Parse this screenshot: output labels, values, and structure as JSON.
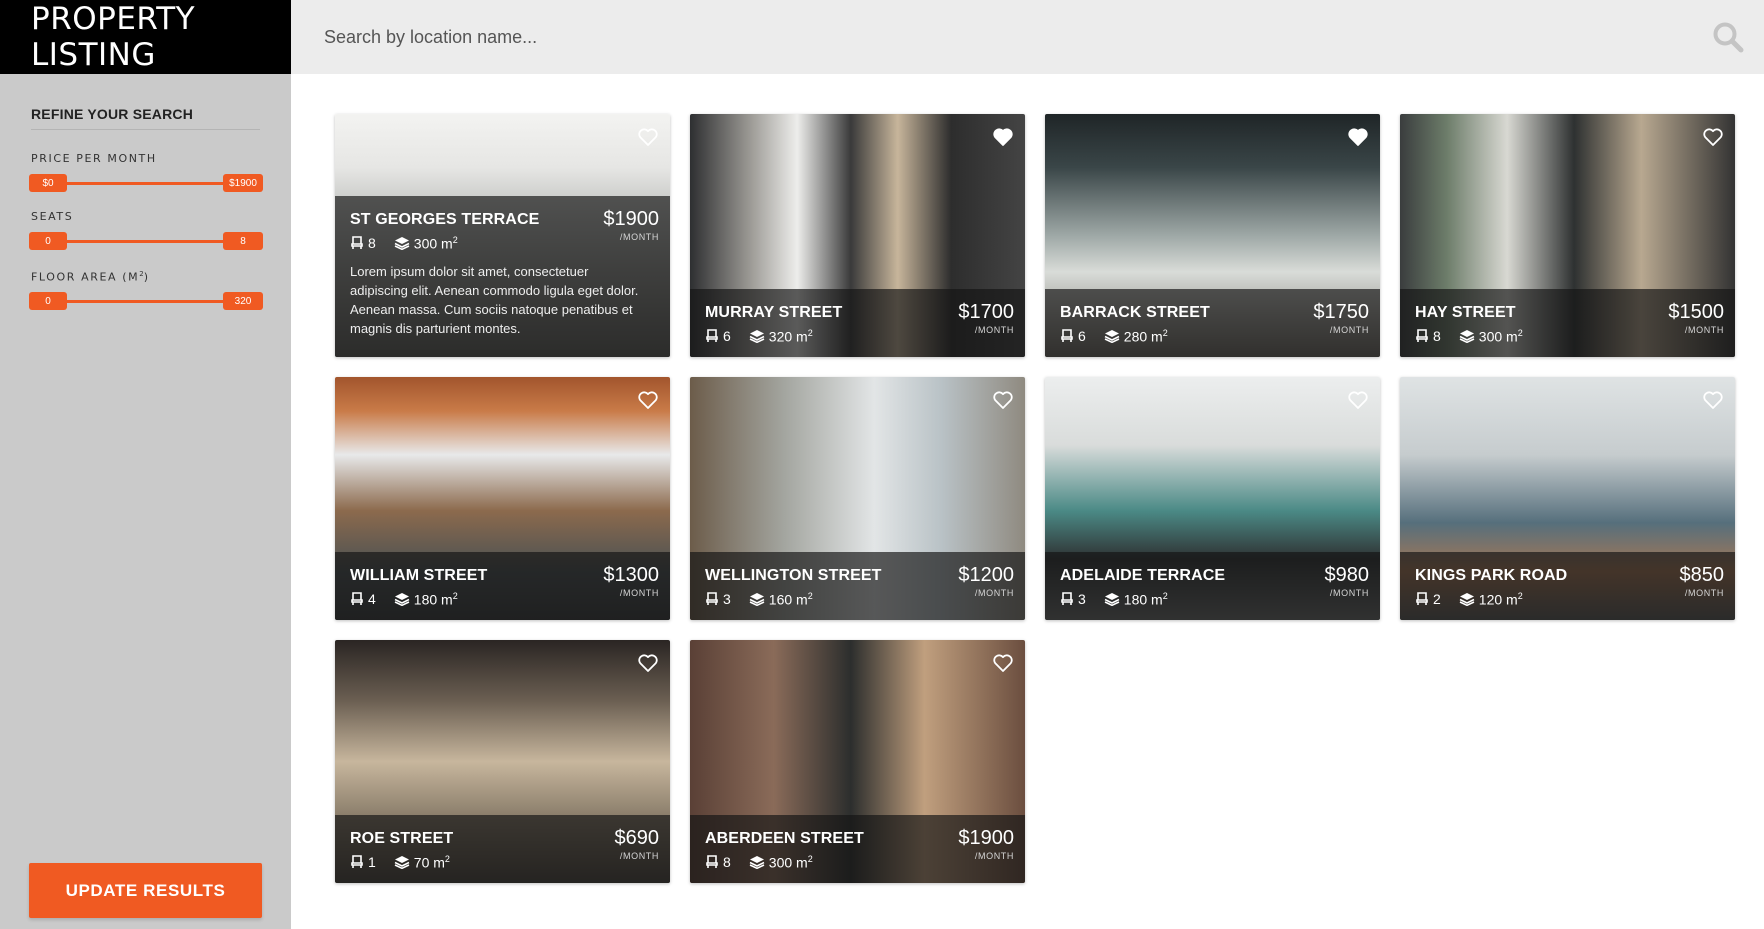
{
  "header": {
    "brand": "PROPERTY LISTING",
    "search_placeholder": "Search by location name...",
    "search_icon": "search-icon"
  },
  "sidebar": {
    "title": "REFINE YOUR SEARCH",
    "filters": [
      {
        "label": "PRICE PER MONTH",
        "min": "$0",
        "max": "$1900"
      },
      {
        "label": "SEATS",
        "min": "0",
        "max": "8"
      },
      {
        "label": "FLOOR AREA (M",
        "label_sup": "2",
        "label_end": ")",
        "min": "0",
        "max": "320"
      }
    ],
    "update_label": "UPDATE RESULTS"
  },
  "listings": [
    {
      "name": "ST GEORGES TERRACE",
      "seats": "8",
      "area": "300 m",
      "price": "$1900",
      "per": "/MONTH",
      "favorite": false,
      "description": "Lorem ipsum dolor sit amet, consectetuer adipiscing elit. Aenean commodo ligula eget dolor. Aenean massa. Cum sociis natoque penatibus et magnis dis parturient montes."
    },
    {
      "name": "MURRAY STREET",
      "seats": "6",
      "area": "320 m",
      "price": "$1700",
      "per": "/MONTH",
      "favorite": true
    },
    {
      "name": "BARRACK STREET",
      "seats": "6",
      "area": "280 m",
      "price": "$1750",
      "per": "/MONTH",
      "favorite": true
    },
    {
      "name": "HAY STREET",
      "seats": "8",
      "area": "300 m",
      "price": "$1500",
      "per": "/MONTH",
      "favorite": false
    },
    {
      "name": "WILLIAM STREET",
      "seats": "4",
      "area": "180 m",
      "price": "$1300",
      "per": "/MONTH",
      "favorite": false
    },
    {
      "name": "WELLINGTON STREET",
      "seats": "3",
      "area": "160 m",
      "price": "$1200",
      "per": "/MONTH",
      "favorite": false
    },
    {
      "name": "ADELAIDE TERRACE",
      "seats": "3",
      "area": "180 m",
      "price": "$980",
      "per": "/MONTH",
      "favorite": false
    },
    {
      "name": "KINGS PARK ROAD",
      "seats": "2",
      "area": "120 m",
      "price": "$850",
      "per": "/MONTH",
      "favorite": false
    },
    {
      "name": "ROE STREET",
      "seats": "1",
      "area": "70 m",
      "price": "$690",
      "per": "/MONTH",
      "favorite": false
    },
    {
      "name": "ABERDEEN STREET",
      "seats": "8",
      "area": "300 m",
      "price": "$1900",
      "per": "/MONTH",
      "favorite": false
    }
  ],
  "area_unit_sup": "2",
  "colors": {
    "accent": "#f05a22",
    "sidebar": "#cacaca",
    "searchbar": "#ececec",
    "brand_bg": "#000000"
  },
  "icons": {
    "seat": "chair-icon",
    "area": "layers-icon",
    "favorite": "heart-icon"
  }
}
